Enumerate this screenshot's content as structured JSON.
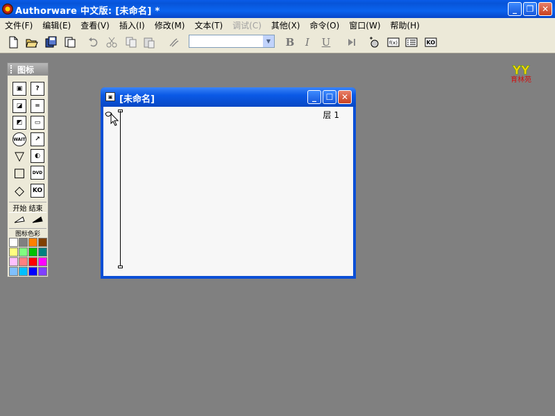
{
  "app": {
    "title": "Authorware 中文版: [未命名] *",
    "controls": [
      "minimize-icon",
      "restore-icon",
      "close-icon"
    ]
  },
  "menu": {
    "items": [
      {
        "label": "文件(F)",
        "enabled": true
      },
      {
        "label": "编辑(E)",
        "enabled": true
      },
      {
        "label": "查看(V)",
        "enabled": true
      },
      {
        "label": "插入(I)",
        "enabled": true
      },
      {
        "label": "修改(M)",
        "enabled": true
      },
      {
        "label": "文本(T)",
        "enabled": true
      },
      {
        "label": "调试(C)",
        "enabled": false
      },
      {
        "label": "其他(X)",
        "enabled": true
      },
      {
        "label": "命令(O)",
        "enabled": true
      },
      {
        "label": "窗口(W)",
        "enabled": true
      },
      {
        "label": "帮助(H)",
        "enabled": true
      }
    ]
  },
  "toolbar": {
    "buttons": [
      "new-icon",
      "open-icon",
      "save-all-icon",
      "import-icon",
      "undo-icon",
      "cut-icon",
      "copy-icon",
      "paste-icon",
      "find-icon"
    ],
    "font_combo_value": "",
    "style_buttons": [
      "B",
      "I",
      "U"
    ],
    "right_buttons": [
      "run-icon",
      "control-panel-icon",
      "functions-icon",
      "variables-icon",
      "knowledge-objects-icon"
    ],
    "logo_text": "育林苑",
    "logo_letters": "YY"
  },
  "palette": {
    "title": "图标",
    "icons": [
      {
        "name": "display-icon",
        "glyph": "▣"
      },
      {
        "name": "motion-icon",
        "glyph": "?"
      },
      {
        "name": "erase-icon",
        "glyph": "◪"
      },
      {
        "name": "wait-icon",
        "glyph": "="
      },
      {
        "name": "navigate-icon",
        "glyph": "◩"
      },
      {
        "name": "framework-icon",
        "glyph": "▭"
      },
      {
        "name": "decision-icon",
        "glyph": "WAIT"
      },
      {
        "name": "interaction-icon",
        "glyph": "↗"
      },
      {
        "name": "calculation-icon",
        "glyph": "▽"
      },
      {
        "name": "map-icon",
        "glyph": "◐"
      },
      {
        "name": "digital-movie-icon",
        "glyph": "□"
      },
      {
        "name": "sound-icon",
        "glyph": "DVD"
      },
      {
        "name": "video-icon",
        "glyph": "◇"
      },
      {
        "name": "knowledge-object-icon",
        "glyph": "KO"
      }
    ],
    "start_end_label": "开始 结束",
    "icon_color_label": "图标色彩",
    "colors": [
      "#ffffff",
      "#808080",
      "#ff8000",
      "#804000",
      "#ffff80",
      "#80ff80",
      "#00c000",
      "#008080",
      "#ffc0ff",
      "#ff8080",
      "#ff0000",
      "#ff00ff",
      "#80c0ff",
      "#00c0ff",
      "#0000ff",
      "#8040ff"
    ]
  },
  "document": {
    "title": "[未命名]",
    "level_label": "层 1"
  }
}
